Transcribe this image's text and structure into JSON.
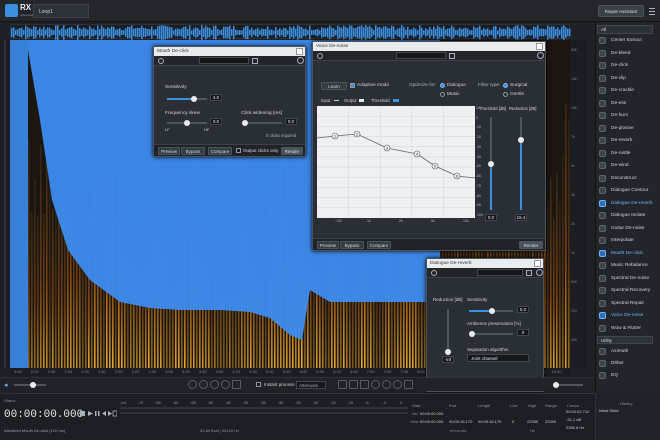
{
  "app": {
    "logo_text": "RX",
    "logo_sub": "Advanced",
    "file_tab": "Loop1",
    "repair_assistant": "Repair Assistant"
  },
  "modules": {
    "filter": "All",
    "items": [
      {
        "label": "Center Extract"
      },
      {
        "label": "De-bleed"
      },
      {
        "label": "De-click"
      },
      {
        "label": "De-clip"
      },
      {
        "label": "De-crackle"
      },
      {
        "label": "De-ess"
      },
      {
        "label": "De-hum"
      },
      {
        "label": "De-plosive"
      },
      {
        "label": "De-reverb"
      },
      {
        "label": "De-rustle"
      },
      {
        "label": "De-wind"
      },
      {
        "label": "Deconstruct"
      },
      {
        "label": "Dialogue Contour"
      },
      {
        "label": "Dialogue De-reverb",
        "active": true
      },
      {
        "label": "Dialogue Isolate"
      },
      {
        "label": "Guitar De-noise"
      },
      {
        "label": "Interpolate"
      },
      {
        "label": "Mouth De-click",
        "active": true
      },
      {
        "label": "Music Rebalance"
      },
      {
        "label": "Spectral De-noise"
      },
      {
        "label": "Spectral Recovery"
      },
      {
        "label": "Spectral Repair"
      },
      {
        "label": "Voice De-noise",
        "active": true
      },
      {
        "label": "Wow & Flutter"
      }
    ],
    "utility_filter": "Utility",
    "utility_items": [
      {
        "label": "Azimuth"
      },
      {
        "label": "Dither"
      },
      {
        "label": "EQ"
      }
    ]
  },
  "time_axis": [
    "0:00",
    "0:20",
    "0:40",
    "1:00",
    "1:20",
    "1:40",
    "2:00",
    "2:20",
    "2:40",
    "3:00",
    "3:20",
    "3:40",
    "4:00",
    "4:20",
    "4:40",
    "5:00",
    "5:20",
    "5:40",
    "6:00",
    "6:20",
    "6:40",
    "7:00",
    "7:20",
    "7:40",
    "8:00",
    "8:20",
    "8:40",
    "9:00",
    "9:20",
    "9:40",
    "10:00",
    "10:20",
    "10:40"
  ],
  "freq_axis": [
    "20k",
    "15k",
    "10k",
    "7k",
    "5k",
    "3k",
    "2k",
    "1k",
    "500",
    "200",
    "100"
  ],
  "mouth_declick": {
    "title": "Mouth De-click",
    "sensitivity_label": "Sensitivity",
    "sensitivity": "4.0",
    "freq_skew_label": "Frequency skew",
    "freq_skew": "0.0",
    "lf": "LF",
    "hf": "HF",
    "click_widening_label": "Click widening [ms]",
    "click_widening": "0.0",
    "clicks_required": "0 clicks required",
    "preview": "Preview",
    "bypass": "Bypass",
    "compare": "Compare",
    "output_clicks": "Output clicks only",
    "render": "Render"
  },
  "voice_denoise": {
    "title": "Voice De-noise",
    "learn": "Learn",
    "adaptive_mode": "Adaptive mode",
    "optimize_for": "Optimize for:",
    "dialogue": "Dialogue",
    "music": "Music",
    "filter_type": "Filter type:",
    "surgical": "Surgical",
    "gentle": "Gentle",
    "input": "Input",
    "output": "Output",
    "threshold": "Threshold",
    "threshold_db": "Threshold [dB]",
    "reduction_db": "Reduction [dB]",
    "threshold_val": "0.0",
    "reduction_val": "15.4",
    "graph_y": [
      "10",
      "0",
      "-10",
      "-20",
      "-30",
      "-40",
      "-50",
      "-60",
      "-70",
      "-80",
      "-90",
      "-100"
    ],
    "graph_x": [
      "-100",
      "1k",
      "2k",
      "5k",
      "10k"
    ],
    "nodes": [
      "1",
      "2",
      "3",
      "4",
      "5",
      "6"
    ],
    "preview": "Preview",
    "bypass": "Bypass",
    "compare": "Compare",
    "render": "Render"
  },
  "dialogue_dereverb": {
    "title": "Dialogue De-reverb",
    "reduction_label": "Reduction [dB]",
    "reduction_val": "-inf",
    "sensitivity_label": "Sensitivity",
    "sensitivity": "5.0",
    "ambience_label": "Ambience preservation [%]",
    "ambience": "0",
    "separation_label": "Separation algorithm",
    "separation": "Joint channel",
    "preview": "Preview",
    "bypass": "Bypass",
    "compare": "Compare",
    "render": "Render"
  },
  "toolbar": {
    "instant_process": "Instant process",
    "mode": "Attenuate"
  },
  "transport": {
    "status_label": "Status",
    "timecode": "00:00:00.000",
    "format": "32-bit float | 44100 Hz",
    "history_label": "History",
    "initial_state": "Initial State",
    "last_action": "Initialized Mouth De-click (120 ms)",
    "sel_label": "Sel",
    "view_label": "View",
    "start_label": "Start",
    "end_label": "End",
    "length_label": "Length",
    "low_label": "Low",
    "high_label": "High",
    "range_label": "Range",
    "cursor_label": "Cursor",
    "sel_start": "00:00:00.000",
    "view_start": "00:00:00.000",
    "view_end": "00:05:16.170",
    "view_length": "00:05:16.170",
    "low": "0",
    "high": "22050",
    "range": "22050",
    "cursor_time": "00:00:02.712",
    "cursor_db": "-31.1 dB",
    "cursor_hz": "2355.8 Hz",
    "time_unit": "h:m:s.ms",
    "hz_unit": "Hz",
    "meter_scale": [
      "-Inf",
      "-70",
      "-65",
      "-60",
      "-55",
      "-50",
      "-45",
      "-40",
      "-35",
      "-30",
      "-25",
      "-20",
      "-15",
      "-10",
      "-6",
      "-3",
      "0"
    ]
  }
}
